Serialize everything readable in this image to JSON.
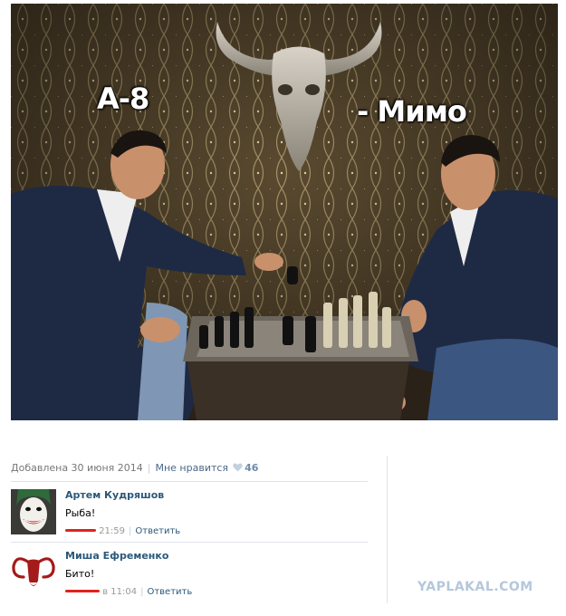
{
  "photo": {
    "caption_left": "А-8",
    "caption_right": "- Мимо"
  },
  "post_meta": {
    "added": "Добавлена 30 июня 2014",
    "like_label": "Мне нравится",
    "like_count": "46"
  },
  "comments": [
    {
      "author": "Артем Кудряшов",
      "text": "Рыба!",
      "time": "21:59",
      "reply_label": "Ответить",
      "avatar_icon": "joker-avatar-icon"
    },
    {
      "author": "Миша Ефременко",
      "text": "Бито!",
      "time": "в 11:04",
      "reply_label": "Ответить",
      "avatar_icon": "ram-logo-avatar-icon"
    }
  ],
  "watermark": "YAPLAKAL.COM",
  "colors": {
    "link": "#2b587a",
    "meta_text": "#777777",
    "redaction": "#e0231c",
    "watermark": "#b5c7db"
  }
}
